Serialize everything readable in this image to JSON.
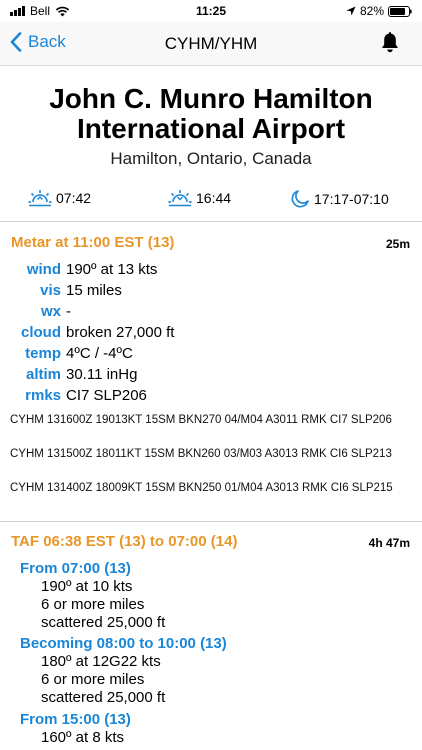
{
  "status_bar": {
    "carrier": "Bell",
    "time": "11:25",
    "battery": "82%"
  },
  "nav": {
    "back_label": "Back",
    "title": "CYHM/YHM"
  },
  "airport": {
    "name_line1": "John C. Munro Hamilton",
    "name_line2": "International Airport",
    "location": "Hamilton, Ontario, Canada"
  },
  "sun": {
    "sunrise": "07:42",
    "sunset": "16:44",
    "moon": "17:17-07:10"
  },
  "metar": {
    "title": "Metar at 11:00 EST (13)",
    "age": "25m",
    "fields": [
      {
        "key": "wind",
        "value": "190º at 13 kts"
      },
      {
        "key": "vis",
        "value": "15 miles"
      },
      {
        "key": "wx",
        "value": "-"
      },
      {
        "key": "cloud",
        "value": "broken 27,000 ft"
      },
      {
        "key": "temp",
        "value": "4ºC / -4ºC"
      },
      {
        "key": "altim",
        "value": "30.11 inHg"
      },
      {
        "key": "rmks",
        "value": "CI7 SLP206"
      }
    ],
    "raw": [
      "CYHM 131600Z 19013KT 15SM BKN270 04/M04 A3011 RMK CI7 SLP206",
      "CYHM 131500Z 18011KT 15SM BKN260 03/M03 A3013 RMK CI6 SLP213",
      "CYHM 131400Z 18009KT 15SM BKN250 01/M04 A3013 RMK CI6 SLP215"
    ]
  },
  "taf": {
    "title": "TAF 06:38 EST (13) to 07:00 (14)",
    "age": "4h 47m",
    "groups": [
      {
        "heading": "From 07:00 (13)",
        "lines": [
          "190º at 10 kts",
          "6 or more miles",
          "scattered 25,000 ft"
        ]
      },
      {
        "heading": "Becoming 08:00 to 10:00 (13)",
        "lines": [
          "180º at 12G22 kts",
          "6 or more miles",
          "scattered 25,000 ft"
        ]
      },
      {
        "heading": "From 15:00 (13)",
        "lines": [
          "160º at 8 kts"
        ]
      }
    ]
  }
}
